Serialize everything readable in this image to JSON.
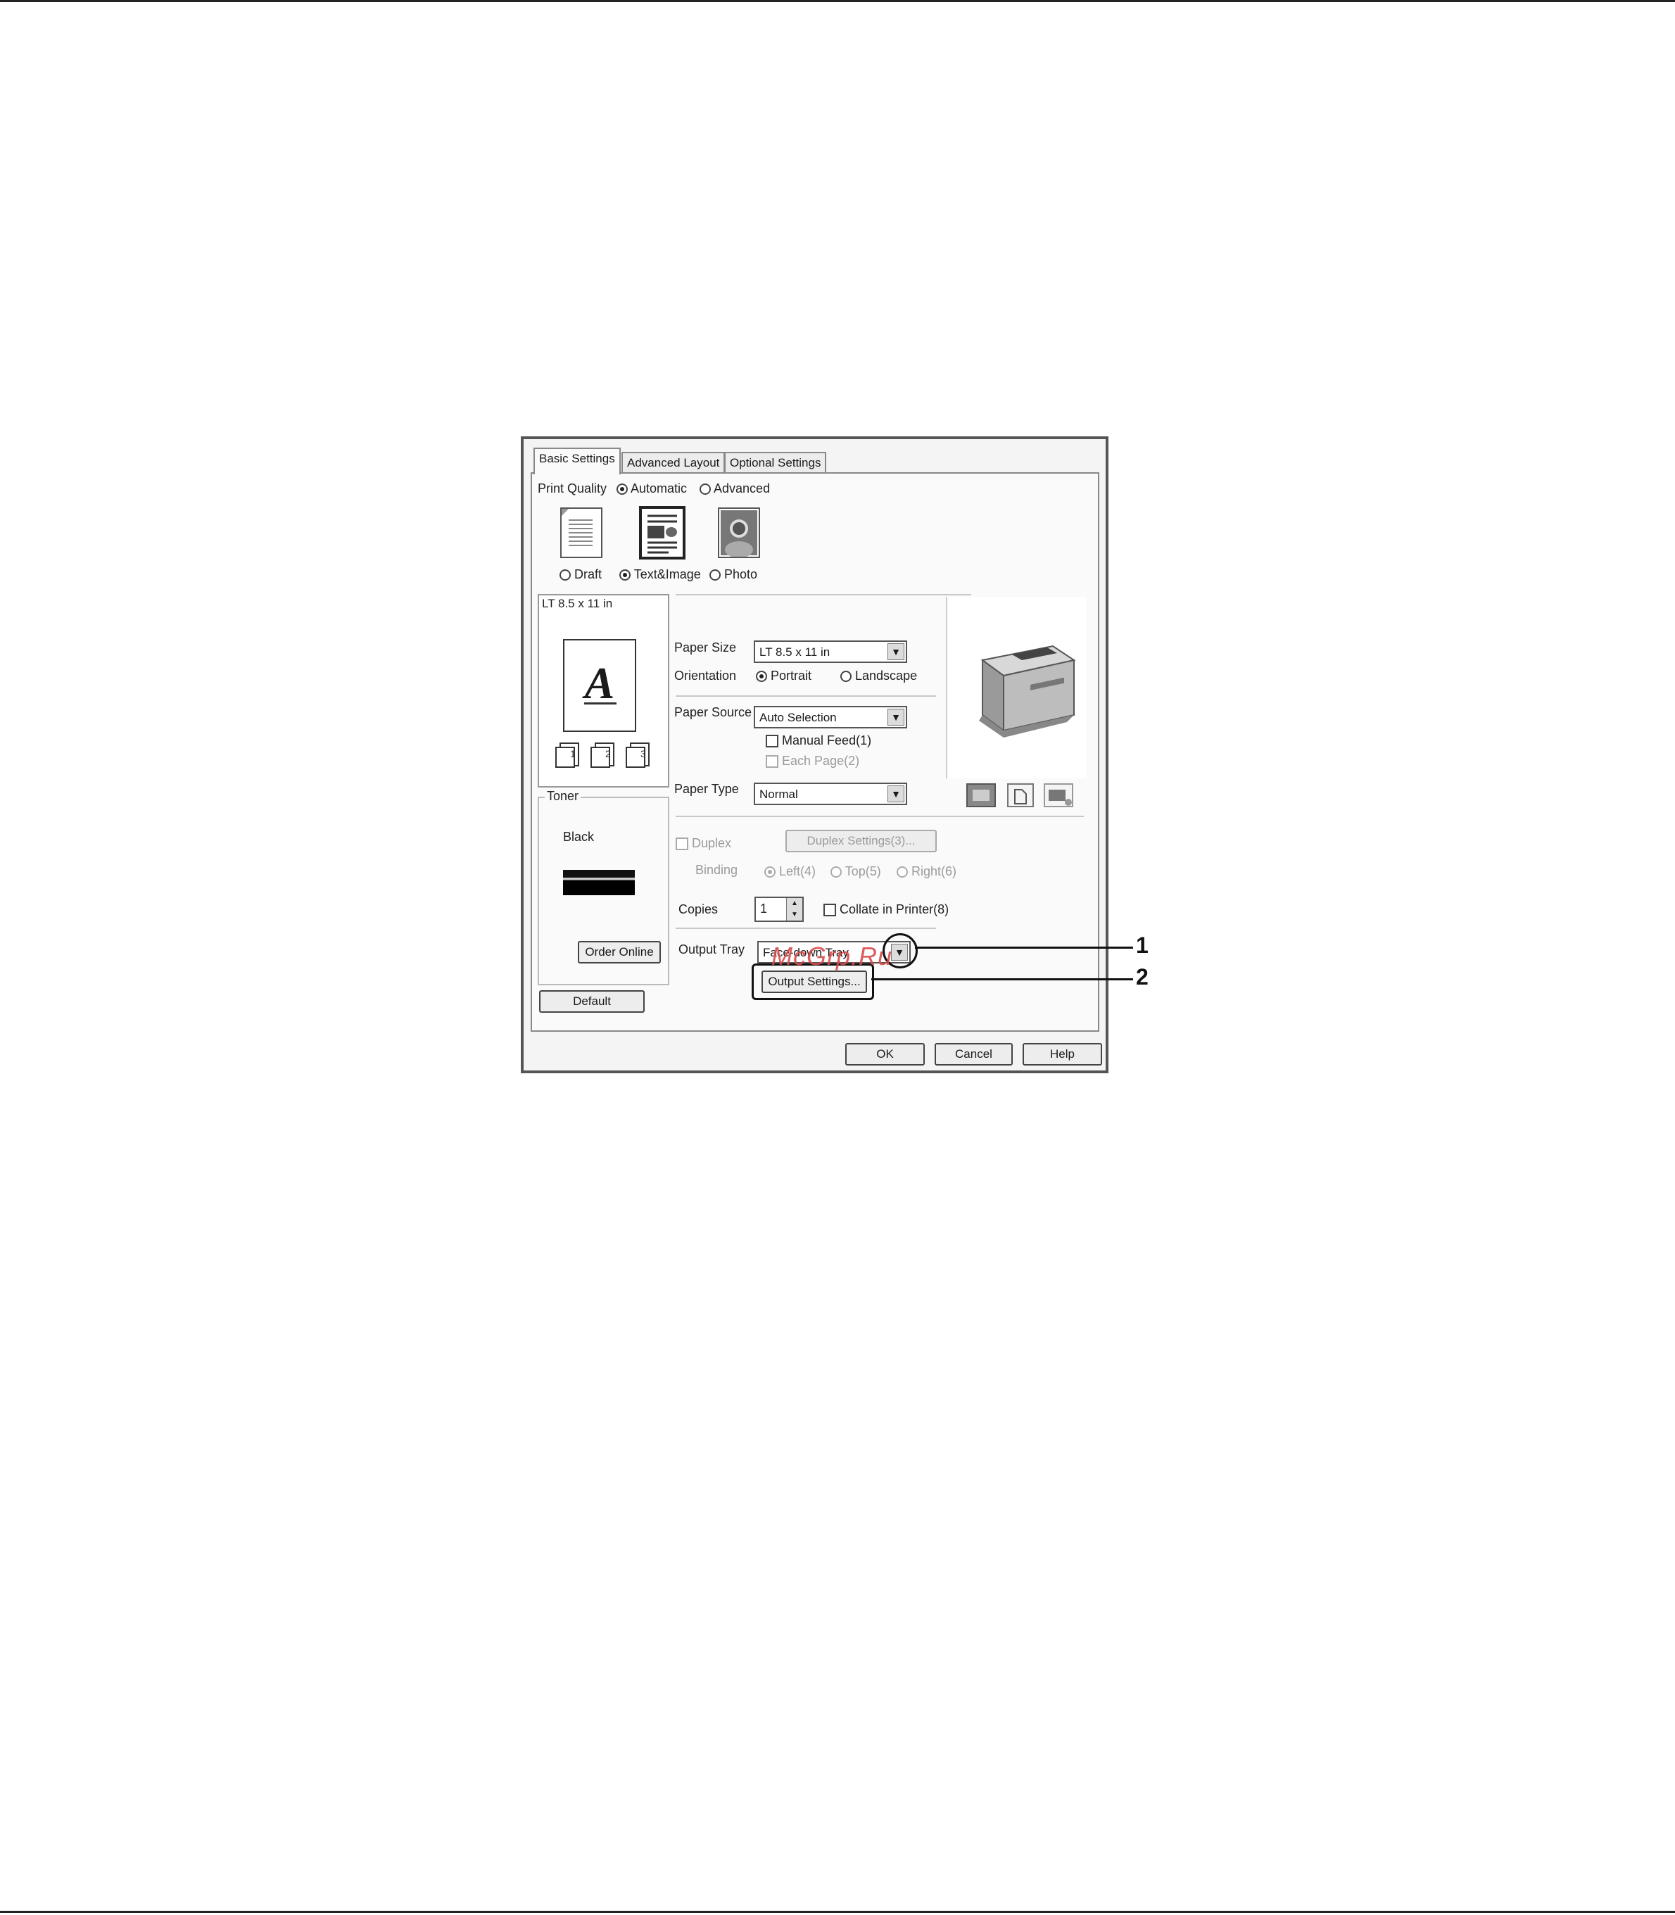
{
  "tabs": [
    {
      "label": "Basic Settings",
      "active": true
    },
    {
      "label": "Advanced Layout",
      "active": false
    },
    {
      "label": "Optional Settings",
      "active": false
    }
  ],
  "print_quality": {
    "label": "Print Quality",
    "mode_options": [
      {
        "label": "Automatic",
        "selected": true
      },
      {
        "label": "Advanced",
        "selected": false
      }
    ],
    "quality_options": [
      {
        "label": "Draft",
        "selected": false
      },
      {
        "label": "Text&Image",
        "selected": true
      },
      {
        "label": "Photo",
        "selected": false
      }
    ]
  },
  "preview": {
    "paper_label": "LT 8.5 x 11 in",
    "glyph": "A"
  },
  "paper_size": {
    "label": "Paper Size",
    "value": "LT 8.5 x 11 in"
  },
  "orientation": {
    "label": "Orientation",
    "options": [
      {
        "label": "Portrait",
        "selected": true
      },
      {
        "label": "Landscape",
        "selected": false
      }
    ]
  },
  "paper_source": {
    "label": "Paper Source",
    "value": "Auto Selection"
  },
  "manual_feed": {
    "label": "Manual Feed(1)",
    "checked": false
  },
  "each_page": {
    "label": "Each Page(2)",
    "checked": false,
    "disabled": true
  },
  "paper_type": {
    "label": "Paper Type",
    "value": "Normal"
  },
  "toner": {
    "label": "Toner",
    "color_label": "Black",
    "order_button": "Order Online"
  },
  "duplex": {
    "label": "Duplex",
    "checked": false,
    "disabled": true,
    "settings_button": "Duplex Settings(3)...",
    "binding_label": "Binding",
    "binding_options": [
      {
        "label": "Left(4)",
        "selected": true
      },
      {
        "label": "Top(5)",
        "selected": false
      },
      {
        "label": "Right(6)",
        "selected": false
      }
    ]
  },
  "copies": {
    "label": "Copies",
    "value": "1"
  },
  "collate": {
    "label": "Collate in Printer(8)",
    "checked": false
  },
  "output_tray": {
    "label": "Output Tray",
    "value": "Face-down Tray",
    "settings_button": "Output Settings..."
  },
  "default_button": "Default",
  "footer_buttons": {
    "ok": "OK",
    "cancel": "Cancel",
    "help": "Help"
  },
  "callouts": [
    "1",
    "2"
  ],
  "watermark": "McGrp.Ru"
}
